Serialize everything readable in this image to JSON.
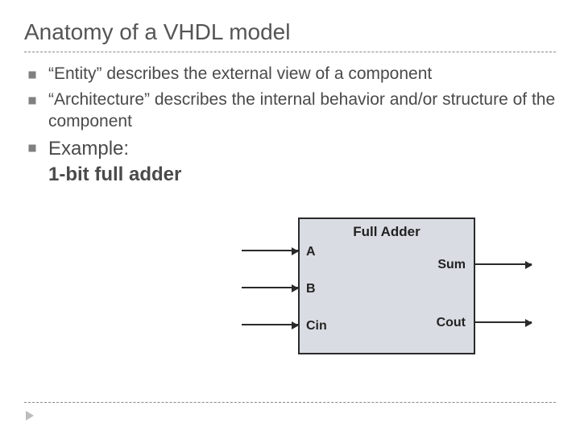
{
  "title": "Anatomy of a VHDL model",
  "bullets": {
    "b1": "“Entity” describes the external view of a component",
    "b2": "“Architecture” describes the internal behavior and/or structure of the component",
    "b3_label": "Example:",
    "b3_name": "1-bit full adder"
  },
  "diagram": {
    "box_title": "Full Adder",
    "ports": {
      "A": "A",
      "B": "B",
      "Cin": "Cin",
      "Sum": "Sum",
      "Cout": "Cout"
    }
  }
}
